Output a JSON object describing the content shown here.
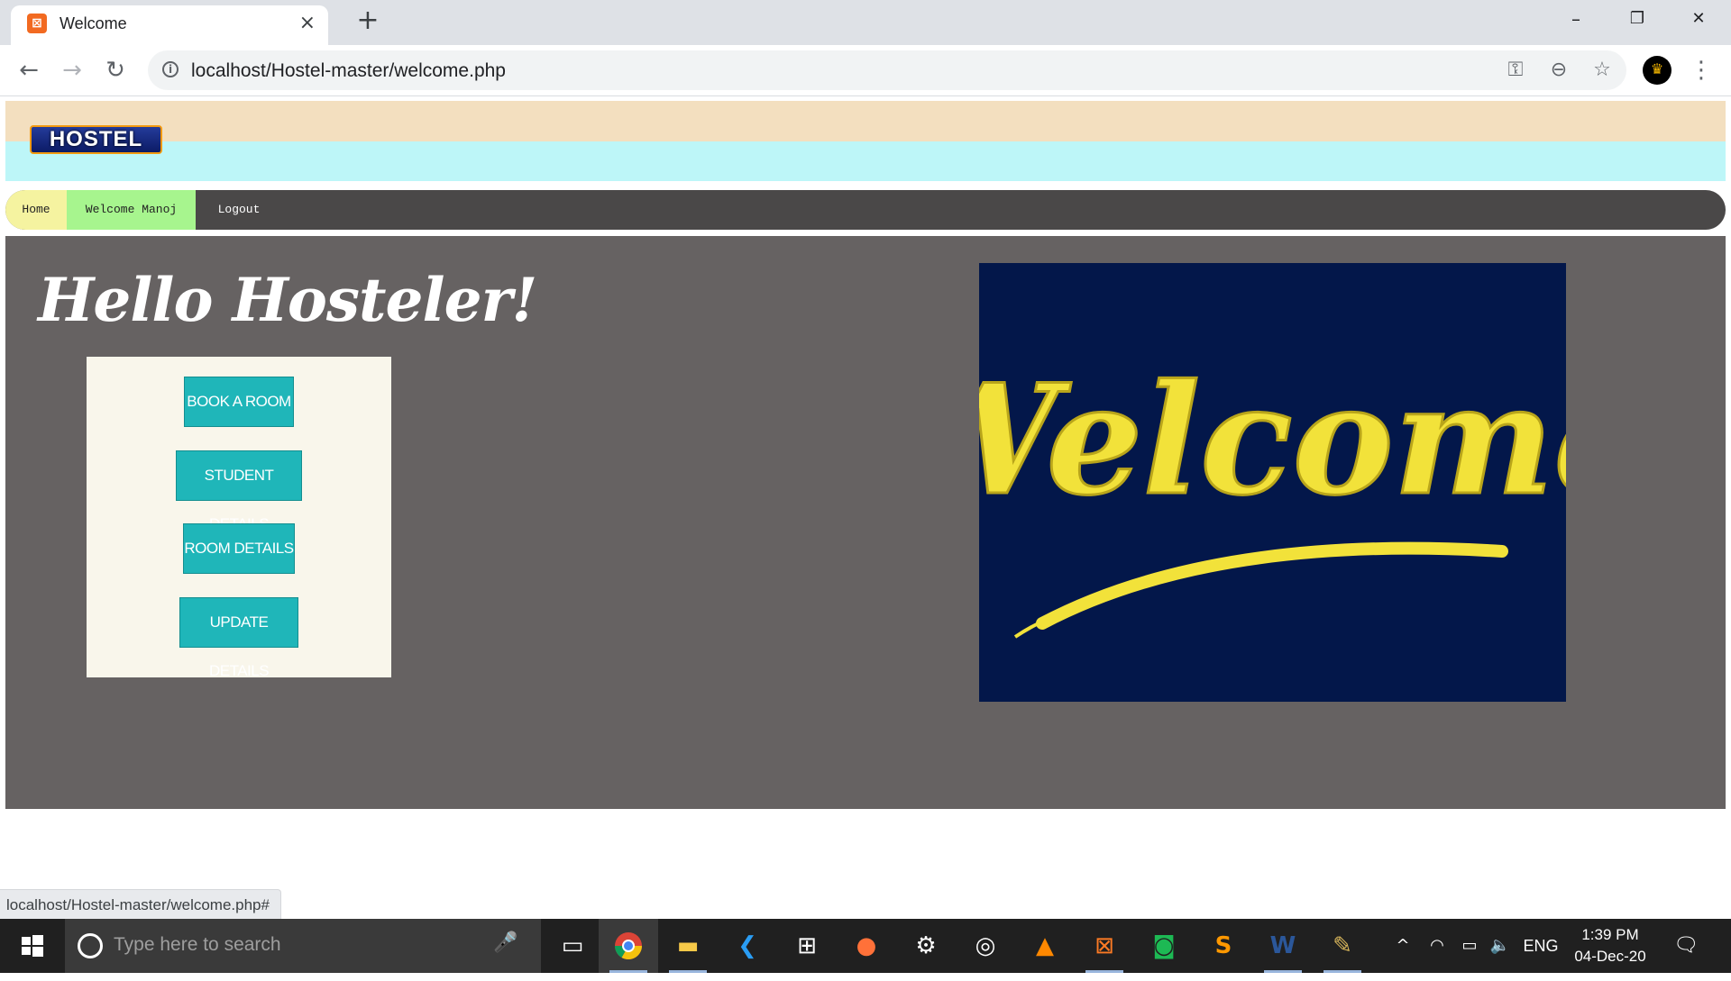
{
  "browser": {
    "tab_title": "Welcome",
    "tab_close": "×",
    "new_tab": "+",
    "url": "localhost/Hostel-master/welcome.php",
    "status_url": "localhost/Hostel-master/welcome.php#",
    "window_controls": [
      "–",
      "❐",
      "✕"
    ]
  },
  "site": {
    "logo": "HOSTEL",
    "nav": [
      {
        "label": "Home",
        "color": "#f5f3a0"
      },
      {
        "label": "Welcome Manoj",
        "color": "#a7f58e"
      },
      {
        "label": "Logout",
        "color": "#4a4848"
      }
    ],
    "heading": "Hello Hosteler!",
    "buttons": [
      {
        "label": "BOOK A ROOM"
      },
      {
        "label": "STUDENT DETAILS"
      },
      {
        "label": "ROOM DETAILS"
      },
      {
        "label": "UPDATE DETAILS"
      }
    ],
    "welcome_image_text": "Welcome"
  },
  "taskbar": {
    "search_placeholder": "Type here to search",
    "language": "ENG",
    "time": "1:39 PM",
    "date": "04-Dec-20"
  },
  "colors": {
    "content_bg": "#666262",
    "button_teal": "#1fb6b9",
    "header_top": "#f3dfbf",
    "header_bottom": "#bdf6f8"
  }
}
